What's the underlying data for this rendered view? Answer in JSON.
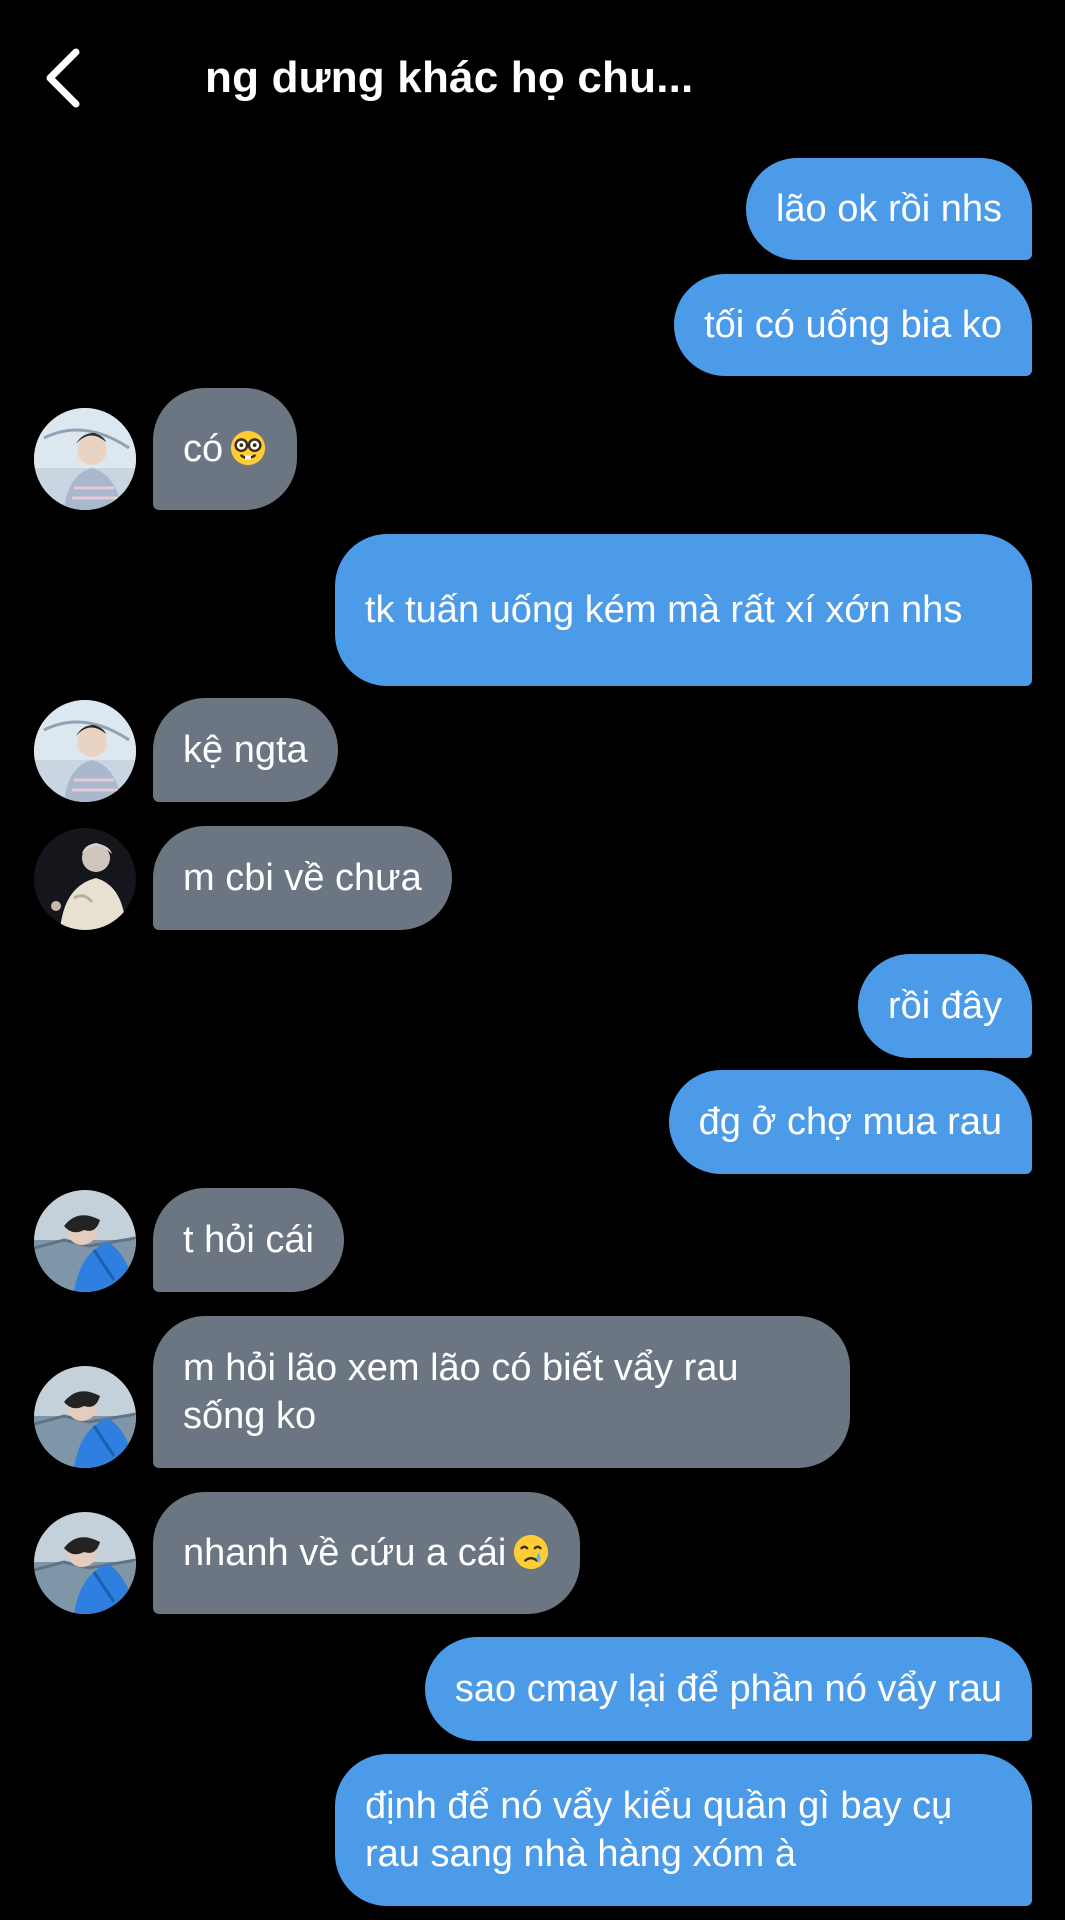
{
  "header": {
    "title": "ng dưng khác họ chu...",
    "back_icon": "chevron-left-icon"
  },
  "colors": {
    "background": "#000000",
    "outgoing_bubble": "#4c9be8",
    "incoming_bubble": "#6b7682",
    "text": "#ffffff"
  },
  "messages": [
    {
      "direction": "outgoing",
      "text": "lão ok rồi nhs"
    },
    {
      "direction": "outgoing",
      "text": "tối có uống bia ko"
    },
    {
      "direction": "incoming",
      "text": "có",
      "emoji": "nerd-face-emoji",
      "avatar": "avatar-sky-shirt"
    },
    {
      "direction": "outgoing",
      "text": "tk tuấn uống kém mà rất xí xớn nhs"
    },
    {
      "direction": "incoming",
      "text": "kệ ngta",
      "avatar": "avatar-sky-shirt"
    },
    {
      "direction": "incoming",
      "text": "m cbi về chưa",
      "avatar": "avatar-dark-coat"
    },
    {
      "direction": "outgoing",
      "text": "rồi đây"
    },
    {
      "direction": "outgoing",
      "text": "đg ở chợ mua rau"
    },
    {
      "direction": "incoming",
      "text": "t hỏi cái",
      "avatar": "avatar-blue-jacket"
    },
    {
      "direction": "incoming",
      "text": "m hỏi lão xem lão có biết vẩy rau sống ko",
      "avatar": "avatar-blue-jacket"
    },
    {
      "direction": "incoming",
      "text": "nhanh về cứu a cái",
      "emoji": "crying-face-emoji",
      "avatar": "avatar-blue-jacket"
    },
    {
      "direction": "outgoing",
      "text": "sao cmay lại để phần nó vẩy rau"
    },
    {
      "direction": "outgoing",
      "text": "định để nó vẩy kiểu quần gì bay cụ rau sang nhà hàng xóm à"
    }
  ]
}
